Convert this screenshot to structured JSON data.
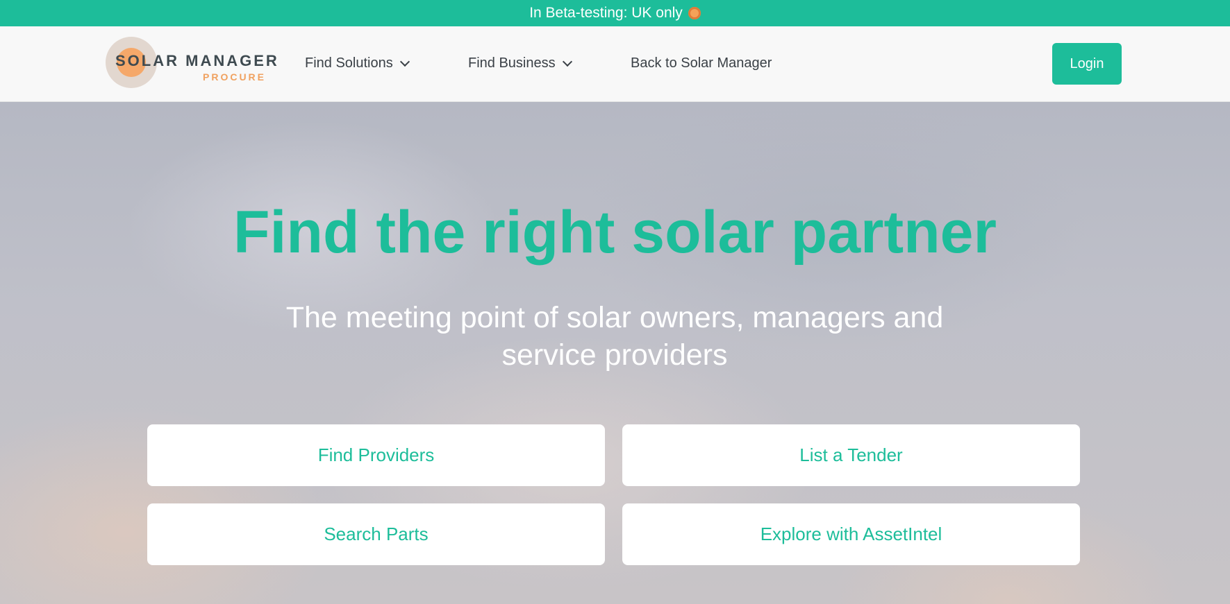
{
  "beta_banner": {
    "text": "In Beta-testing: UK only",
    "icon": "sun-icon"
  },
  "brand": {
    "name": "SOLAR MANAGER",
    "sub": "PROCURE",
    "accent": "#1dbd9a",
    "logo_orange": "#f0a15f"
  },
  "nav": {
    "items": [
      {
        "label": "Find Solutions",
        "has_dropdown": true
      },
      {
        "label": "Find Business",
        "has_dropdown": true
      },
      {
        "label": "Back to Solar Manager",
        "has_dropdown": false
      }
    ],
    "login_label": "Login"
  },
  "hero": {
    "headline": "Find the right solar partner",
    "subheadline_line1": "The meeting point of solar owners, managers and",
    "subheadline_line2": "service providers",
    "actions": [
      {
        "label": "Find Providers"
      },
      {
        "label": "List a Tender"
      },
      {
        "label": "Search Parts"
      },
      {
        "label": "Explore with AssetIntel"
      }
    ]
  }
}
